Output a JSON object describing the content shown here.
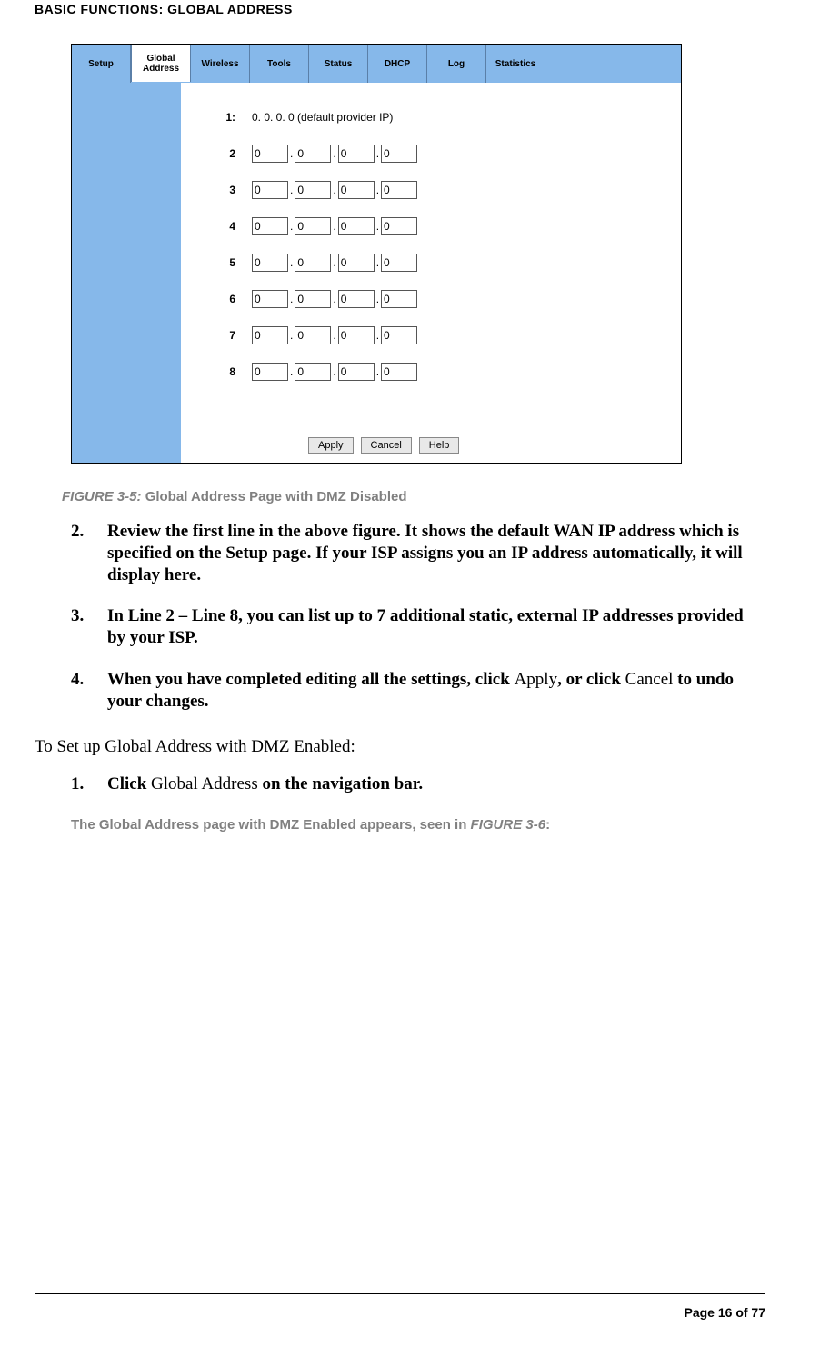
{
  "header": {
    "title": "BASIC FUNCTIONS: GLOBAL ADDRESS"
  },
  "figure1": {
    "tabs": [
      "Setup",
      "Global Address",
      "Wireless",
      "Tools",
      "Status",
      "DHCP",
      "Log",
      "Statistics"
    ],
    "active_tab_index": 1,
    "rows": {
      "labels": [
        "1:",
        "2",
        "3",
        "4",
        "5",
        "6",
        "7",
        "8"
      ],
      "default_text": "0. 0. 0. 0 (default provider IP)",
      "ip": {
        "a": "0",
        "b": "0",
        "c": "0",
        "d": "0"
      }
    },
    "buttons": {
      "apply": "Apply",
      "cancel": "Cancel",
      "help": "Help"
    },
    "caption_label": "FIGURE 3-5:",
    "caption_text": "Global Address Page with DMZ Disabled"
  },
  "steps_a": {
    "s2": {
      "num": "2.",
      "text": "Review the first line in the above figure. It shows the default WAN IP address which is specified on the Setup page. If your ISP assigns you an IP address automatically, it will display here."
    },
    "s3": {
      "num": "3.",
      "text": "In Line 2 – Line 8, you can list up to 7 additional static, external IP addresses provided by your ISP."
    },
    "s4": {
      "num": "4.",
      "pre": "When you have completed editing all the settings, click ",
      "apply": "Apply",
      "mid": ", or click ",
      "cancel": "Cancel",
      "post": " to undo your changes."
    }
  },
  "section2": {
    "intro": "To Set up Global Address with DMZ Enabled:",
    "s1": {
      "num": "1.",
      "pre": "Click ",
      "link": "Global Address",
      "post": " on the navigation bar."
    },
    "note_pre": "The Global Address page with DMZ Enabled appears, seen in ",
    "note_fig": "FIGURE 3-6",
    "note_post": ":"
  },
  "footer": {
    "page": "Page 16 of 77"
  }
}
